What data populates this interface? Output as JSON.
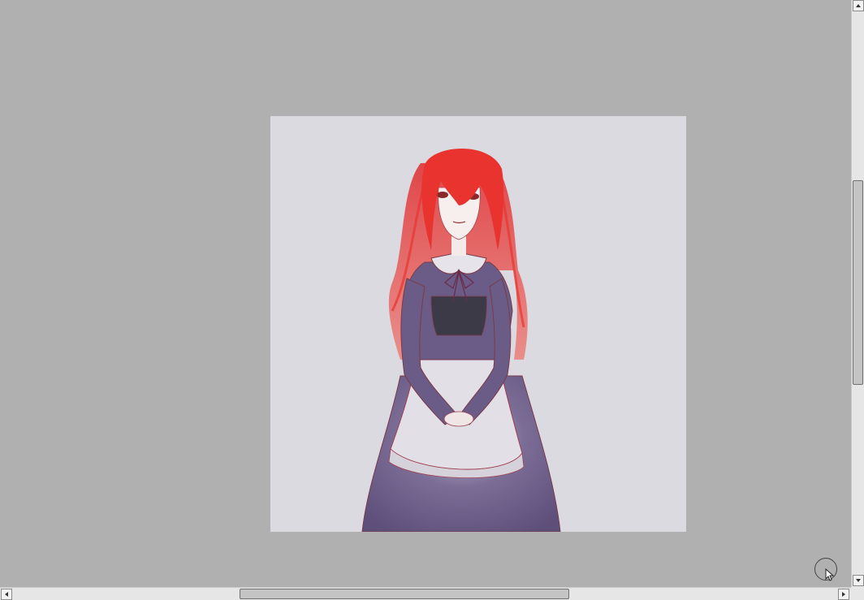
{
  "app": {
    "canvas_background": "#dadae0",
    "workspace_background": "#b0b0b0"
  },
  "artwork": {
    "subject": "",
    "hair_color": "#e8332f",
    "dress_color": "#6a5c86",
    "apron_color": "#e2e0e6"
  },
  "scrollbars": {
    "vertical": {
      "thumb_start_fraction": 0.31,
      "thumb_size_fraction": 0.35
    },
    "horizontal": {
      "thumb_start_fraction": 0.28,
      "thumb_size_fraction": 0.39
    }
  },
  "icons": {
    "scroll_up": "arrow-up-icon",
    "scroll_down": "arrow-down-icon",
    "scroll_left": "arrow-left-icon",
    "scroll_right": "arrow-right-icon",
    "brush": "brush-cursor-icon"
  }
}
